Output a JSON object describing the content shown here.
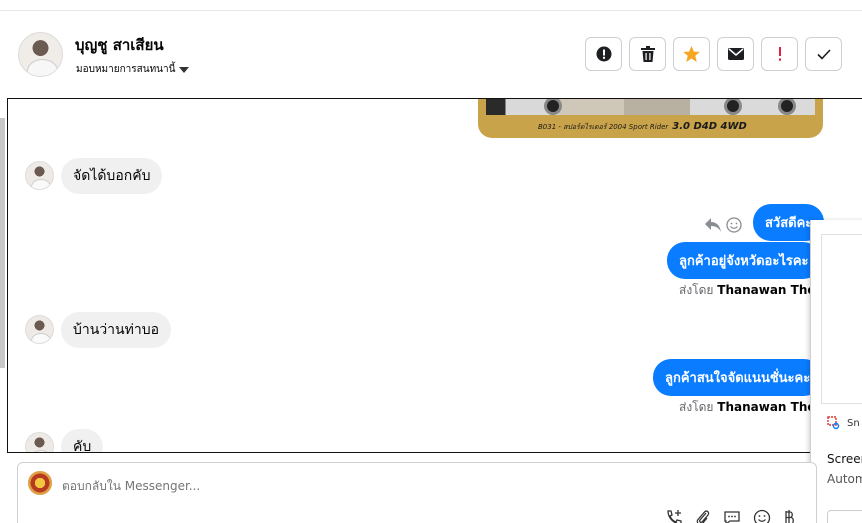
{
  "header": {
    "contact_name": "บุญชู สาเสียน",
    "assign_label": "มอบหมายการสนทนานี้"
  },
  "chat": {
    "image_caption": "B031 - สปอร์ตไรเดอร์ 2004 Sport Rider",
    "image_caption_bold": "3.0 D4D 4WD",
    "messages": {
      "in1": "จัดได้บอกคับ",
      "out1": "สวัสดีคะ",
      "out2": "ลูกค้าอยู่จังหวัดอะไรคะ",
      "sent1_prefix": "ส่งโดย",
      "sent1_name": "Thanawan Thon",
      "in2": "บ้านว่านท่าบอ",
      "out3": "ลูกค้าสนใจจัดแนนชั่นะคะ",
      "sent2_prefix": "ส่งโดย",
      "sent2_name": "Thanawan Thon",
      "in3": "คับ"
    }
  },
  "side_panel": {
    "row1": "Sn",
    "row2": "Screer",
    "row3": "Autom"
  },
  "composer": {
    "placeholder": "ตอบกลับใน Messenger..."
  },
  "colors": {
    "accent": "#0a7cff",
    "star": "#f5a623",
    "alert": "#e41e3f"
  }
}
